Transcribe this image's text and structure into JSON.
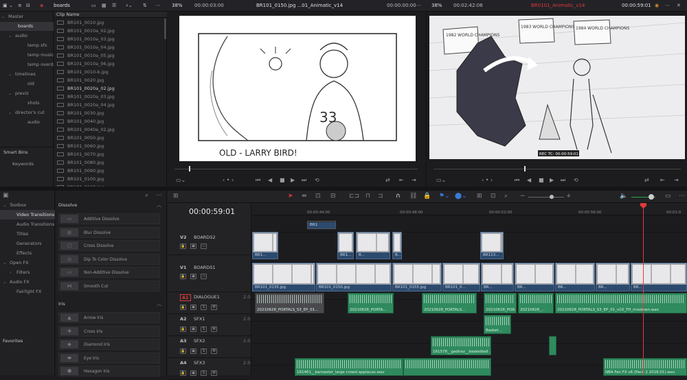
{
  "topbar": {
    "bin_name": "boards",
    "src_zoom": "38%",
    "src_timecode": "00:00:03:00",
    "src_clip_title": "BR101_0150.jpg ...01_Animatic_v14",
    "src_duration": "00:00:00:00",
    "tl_zoom": "38%",
    "tl_timecode": "00:02:42:06",
    "tl_name": "BR0101_Animatic_v14",
    "tl_duration": "00:00:59:01"
  },
  "bins": [
    {
      "label": "Master",
      "level": 0,
      "arrow": "⌄"
    },
    {
      "label": "boards",
      "level": 1,
      "selected": true
    },
    {
      "label": "audio",
      "level": 1,
      "arrow": "⌄"
    },
    {
      "label": "temp sfx",
      "level": 2
    },
    {
      "label": "temp music",
      "level": 2
    },
    {
      "label": "temp overd...",
      "level": 2
    },
    {
      "label": "timelines",
      "level": 1,
      "arrow": "⌄"
    },
    {
      "label": "old",
      "level": 2
    },
    {
      "label": "previz",
      "level": 1,
      "arrow": "⌄"
    },
    {
      "label": "shots",
      "level": 2
    },
    {
      "label": "director's cut",
      "level": 1,
      "arrow": "⌄"
    },
    {
      "label": "audio",
      "level": 2
    }
  ],
  "smart_bins": {
    "title": "Smart Bins",
    "items": [
      "Keywords"
    ]
  },
  "clip_list": {
    "header": "Clip Name",
    "clips": [
      "BR101_0010.jpg",
      "BR101_0010a_02.jpg",
      "BR101_0010a_03.jpg",
      "BR101_0010a_04.jpg",
      "BR101_0010a_05.jpg",
      "BR101_0010a_06.jpg",
      "BR101_0010-b.jpg",
      "BR101_0020.jpg",
      "BR101_0020a_02.jpg",
      "BR101_0020a_03.jpg",
      "BR101_0020a_04.jpg",
      "BR101_0030.jpg",
      "BR101_0040.jpg",
      "BR101_0040a_02.jpg",
      "BR101_0050.jpg",
      "BR101_0060.jpg",
      "BR101_0070.jpg",
      "BR101_0080.jpg",
      "BR101_0090.jpg",
      "BR101_0100.jpg",
      "BR101_0110.jpg"
    ],
    "highlighted_index": 8
  },
  "source_frame": {
    "caption": "OLD - LARRY BIRD!",
    "jersey": "33"
  },
  "timeline_frame": {
    "banners": [
      "1982 WORLD CHAMPIONS",
      "1983 WORLD CHAMPIONS",
      "1984 WORLD CHAMPIONS"
    ],
    "rec_tc": "REC TC: 00:00:59:01"
  },
  "toolbox": {
    "items": [
      {
        "label": "Toolbox",
        "level": 0,
        "arrow": "⌄"
      },
      {
        "label": "Video Transitions",
        "level": 1,
        "selected": true
      },
      {
        "label": "Audio Transitions",
        "level": 1
      },
      {
        "label": "Titles",
        "level": 1
      },
      {
        "label": "Generators",
        "level": 1
      },
      {
        "label": "Effects",
        "level": 1
      },
      {
        "label": "Open FX",
        "level": 0,
        "arrow": "⌄"
      },
      {
        "label": "Filters",
        "level": 1,
        "arrow": "›"
      },
      {
        "label": "Audio FX",
        "level": 0,
        "arrow": "⌄"
      },
      {
        "label": "Fairlight FX",
        "level": 1
      }
    ],
    "favorites": "Favorites"
  },
  "effects": {
    "dissolve_header": "Dissolve",
    "dissolve": [
      "Additive Dissolve",
      "Blur Dissolve",
      "Cross Dissolve",
      "Dip To Color Dissolve",
      "Non-Additive Dissolve",
      "Smooth Cut"
    ],
    "iris_header": "Iris",
    "iris": [
      "Arrow Iris",
      "Cross Iris",
      "Diamond Iris",
      "Eye Iris",
      "Hexagon Iris"
    ]
  },
  "timeline": {
    "timecode": "00:00:59:01",
    "ruler": [
      "00:00:44:00",
      "00:00:48:00",
      "00:00:52:00",
      "00:00:56:00",
      "00:01:0"
    ],
    "tracks": [
      {
        "id": "V2",
        "name": "BOARDS2",
        "count": "4 Clips"
      },
      {
        "id": "V1",
        "name": "BOARDS1",
        "count": "149 Clips"
      },
      {
        "id": "A1",
        "name": "DIALOGUE1",
        "level": "2.0"
      },
      {
        "id": "A2",
        "name": "SFX1",
        "level": "2.0"
      },
      {
        "id": "A3",
        "name": "SFX2",
        "level": "2.0"
      },
      {
        "id": "A4",
        "name": "SFX3",
        "level": "2.0"
      }
    ],
    "dialogue_clips": [
      "20210628_PORTALS_S3_EP_01...",
      "20210628_PORTA...",
      "20210628_PORTALS...",
      "20210628_POR...",
      "20210628_...",
      "20210628_PORTALS_S3_EP_01_v10_TH_mixdown.wav"
    ],
    "sfx1_clip": "Basket...",
    "sfx2_clip": "161578__gadiraz__basketball ...",
    "sfx3_clips": [
      "161461__barnaster_large crowd applause.wav",
      "",
      "NBA Fan FX v6 (Pack 2 2018.01).wav"
    ],
    "v2_clip_labels": [
      "BR1...",
      "BR1...",
      "B...",
      "B...",
      "BR113...",
      "BR1"
    ],
    "v1_clip_labels": [
      "BR101_0135.jpg",
      "BR101_0150.jpg",
      "BR101_0155.jpg",
      "BR101_0...",
      "BR...",
      "BR...",
      "BR...",
      "BR...",
      "BR..."
    ]
  },
  "colors": {
    "accent_red": "#e0393a",
    "video_clip": "#2c4a6e",
    "audio_clip": "#2f8a5e"
  }
}
